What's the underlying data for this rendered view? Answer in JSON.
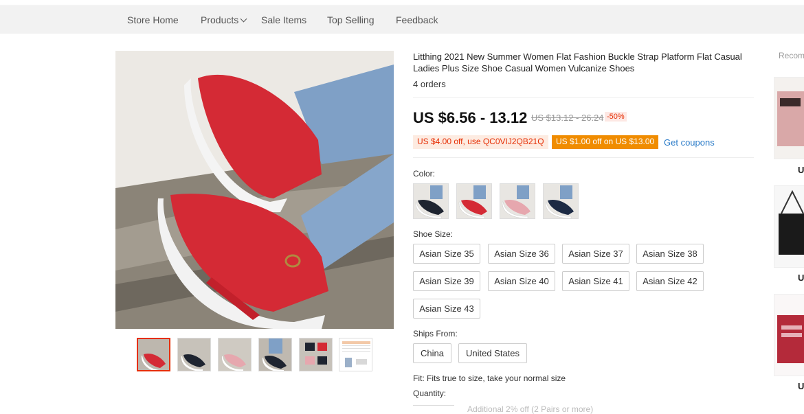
{
  "nav": {
    "items": [
      "Store Home",
      "Products",
      "Sale Items",
      "Top Selling",
      "Feedback"
    ]
  },
  "product": {
    "title": "Litthing 2021 New Summer Women Flat Fashion Buckle Strap Platform Flat Casual Ladies Plus Size Shoe Casual Women Vulcanize Shoes",
    "orders": "4 orders",
    "price": "US $6.56 - 13.12",
    "price_old": "US $13.12 - 26.24",
    "discount": "-50%",
    "coupon1": "US $4.00 off, use QC0VIJ2QB21Q",
    "coupon2": "US $1.00 off on US $13.00",
    "get_coupons": "Get coupons",
    "color_label": "Color:",
    "size_label": "Shoe Size:",
    "sizes": [
      "Asian Size 35",
      "Asian Size 36",
      "Asian Size 37",
      "Asian Size 38",
      "Asian Size 39",
      "Asian Size 40",
      "Asian Size 41",
      "Asian Size 42",
      "Asian Size 43"
    ],
    "ships_label": "Ships From:",
    "ships": [
      "China",
      "United States"
    ],
    "fit": "Fit: Fits true to size, take your normal size",
    "quantity_label": "Quantity:",
    "cut_text": "Additional 2% off (2 Pairs or more)"
  },
  "recommend": {
    "title": "Recom",
    "prices": [
      "U",
      "U",
      "U"
    ]
  },
  "colors": {
    "accent": "#e62e04",
    "coupon_orange": "#f08c00",
    "link": "#2a7bc8",
    "shoe_red": "#d42a35"
  }
}
